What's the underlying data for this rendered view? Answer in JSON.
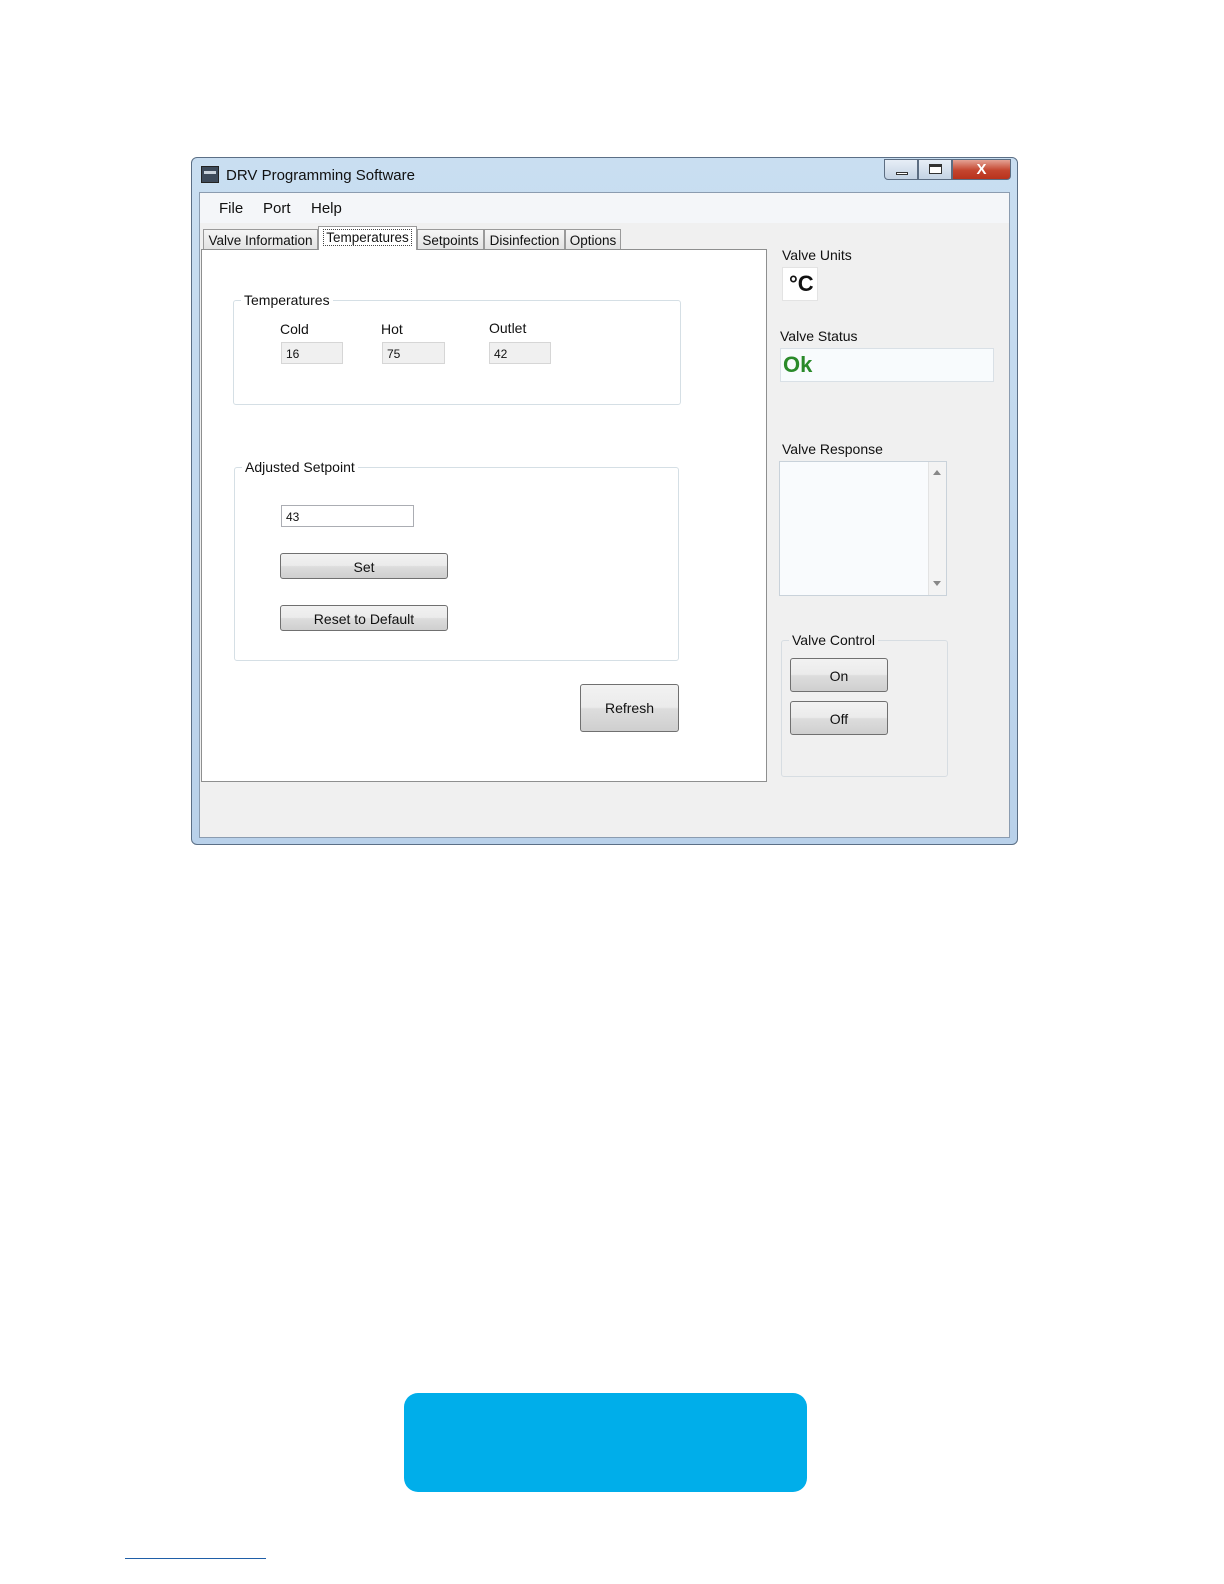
{
  "window": {
    "title": "DRV Programming Software",
    "close_label": "X"
  },
  "menu": {
    "items": [
      "File",
      "Port",
      "Help"
    ]
  },
  "tabs": [
    {
      "label": "Valve Information",
      "active": false
    },
    {
      "label": "Temperatures",
      "active": true
    },
    {
      "label": "Setpoints",
      "active": false
    },
    {
      "label": "Disinfection",
      "active": false
    },
    {
      "label": "Options",
      "active": false
    }
  ],
  "temperatures": {
    "group_label": "Temperatures",
    "cold_label": "Cold",
    "cold_value": "16",
    "hot_label": "Hot",
    "hot_value": "75",
    "outlet_label": "Outlet",
    "outlet_value": "42"
  },
  "adjusted_setpoint": {
    "group_label": "Adjusted Setpoint",
    "value": "43",
    "set_label": "Set",
    "reset_label": "Reset to Default"
  },
  "refresh_label": "Refresh",
  "valve_units": {
    "label": "Valve Units",
    "value": "°C"
  },
  "valve_status": {
    "label": "Valve Status",
    "value": "Ok",
    "color": "#2a8a2a"
  },
  "valve_response": {
    "label": "Valve Response",
    "value": ""
  },
  "valve_control": {
    "group_label": "Valve Control",
    "on_label": "On",
    "off_label": "Off"
  },
  "colors": {
    "accent_box": "#00aeea"
  }
}
